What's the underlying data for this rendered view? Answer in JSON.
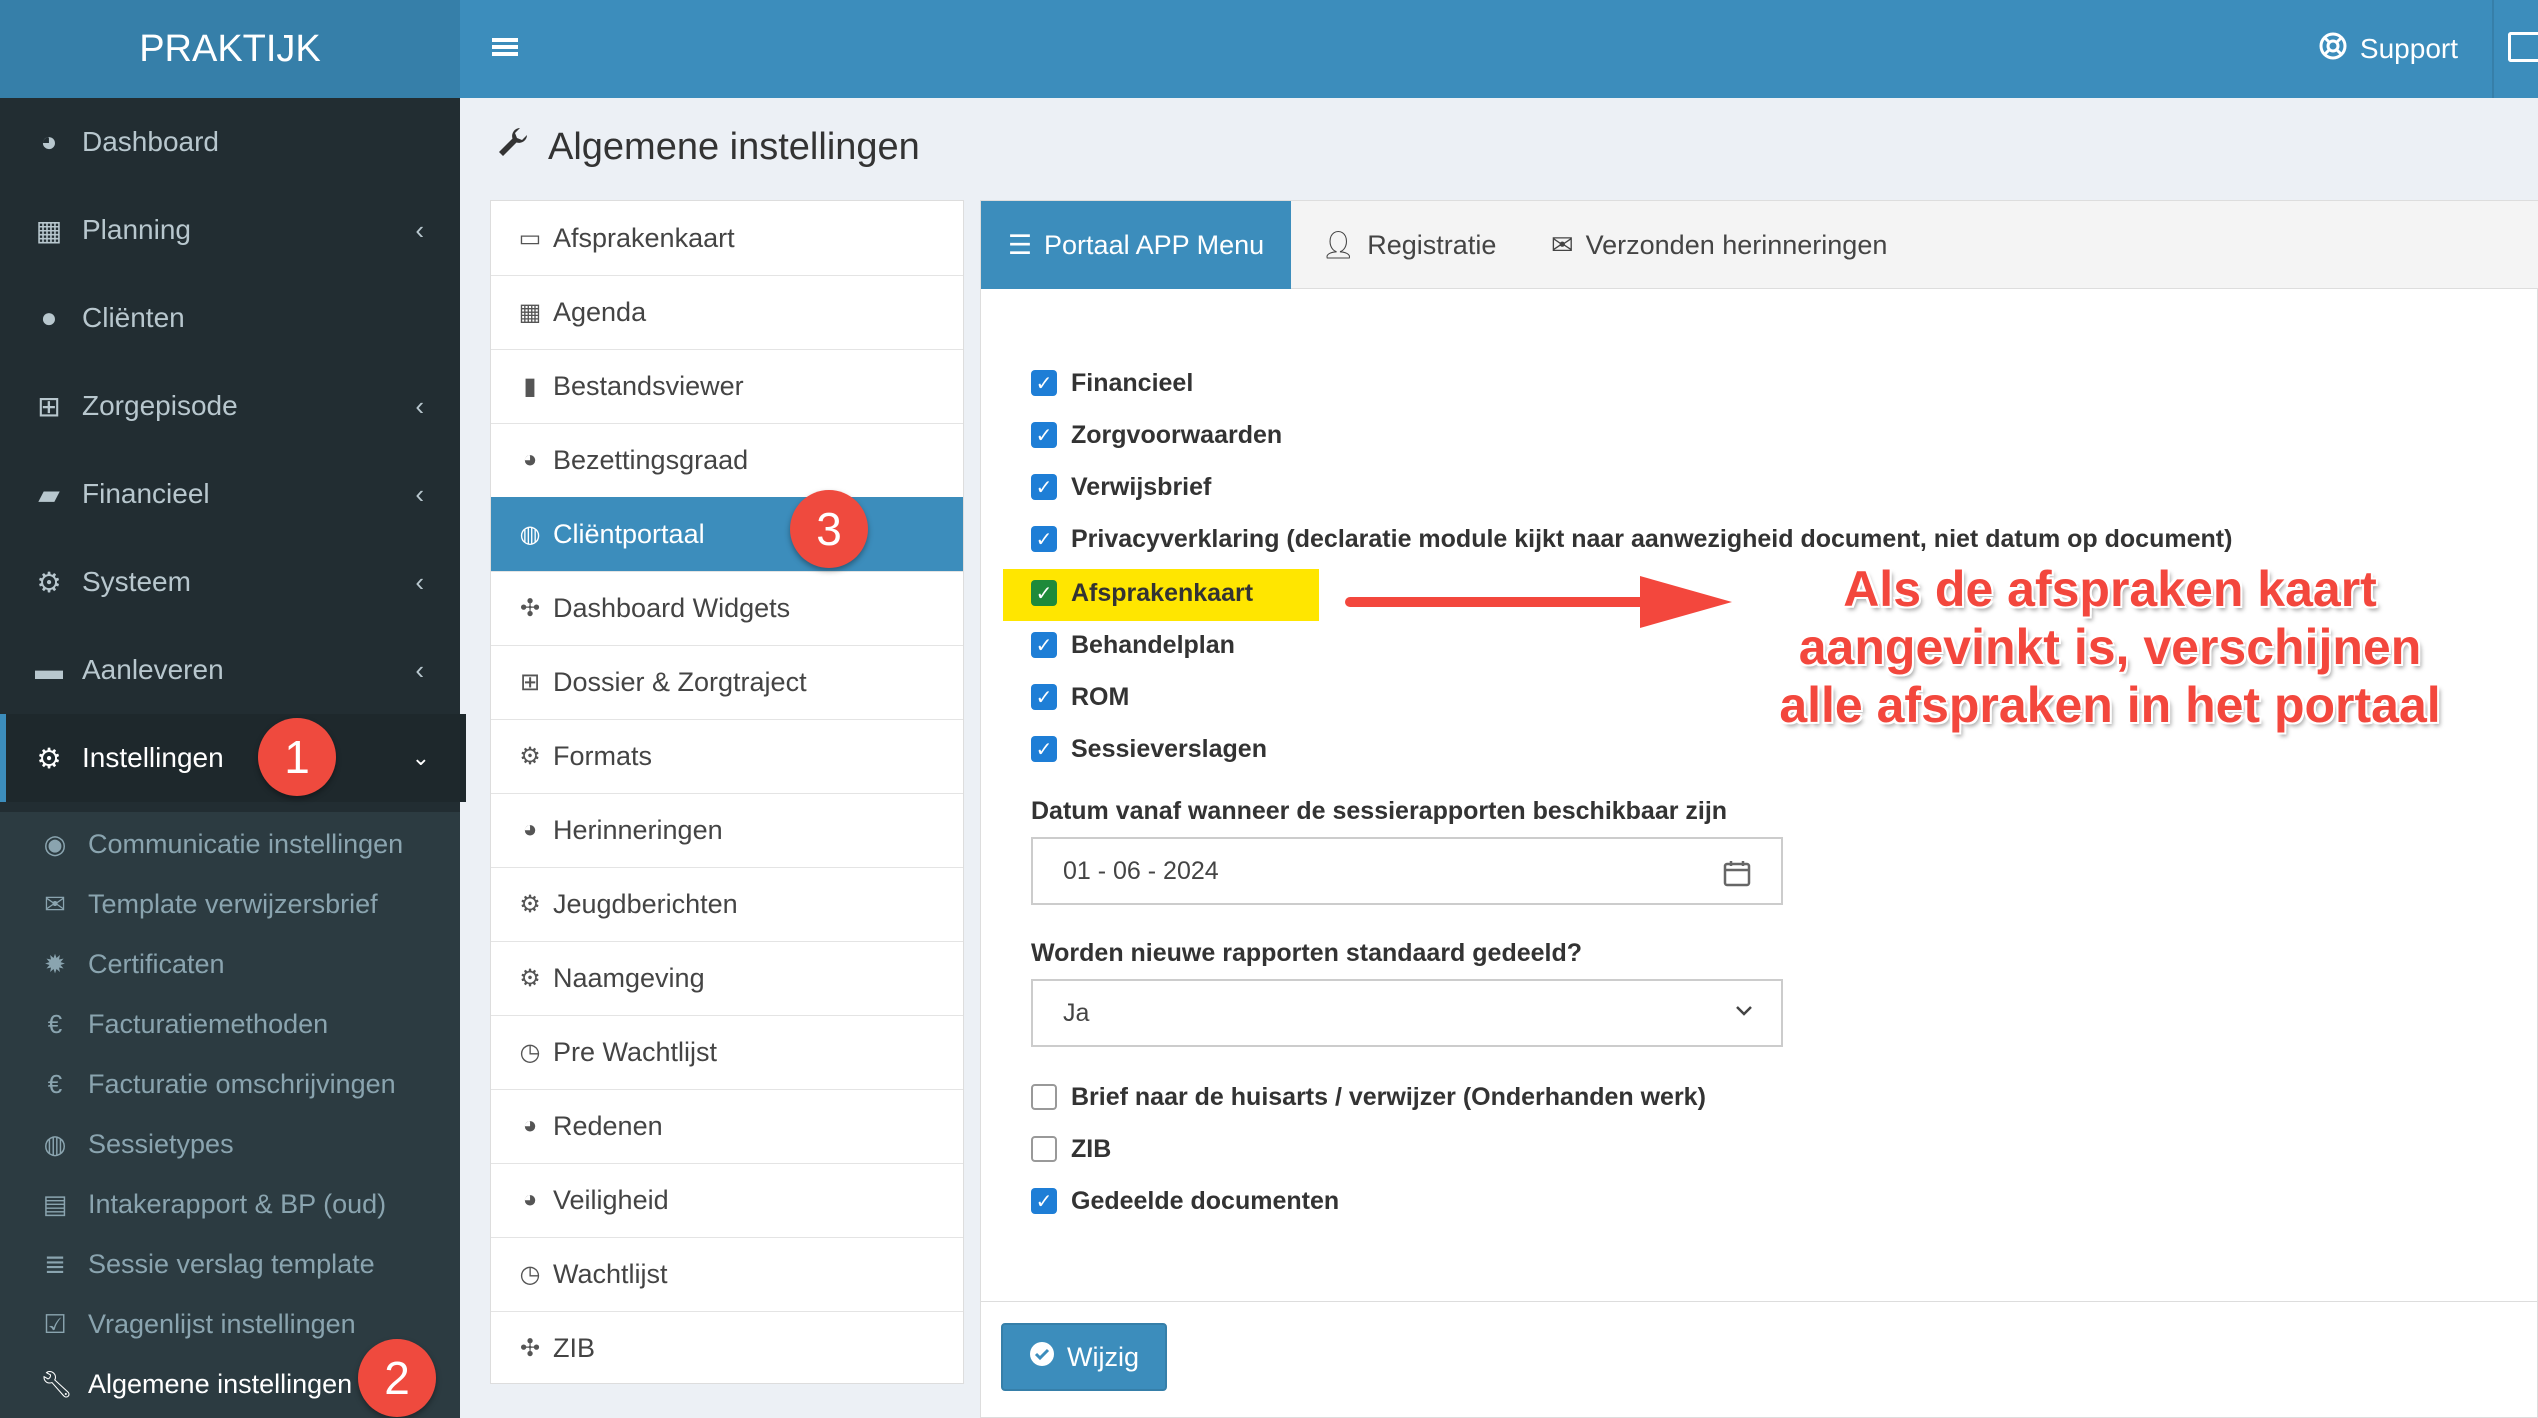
{
  "brand": "PRAKTIJK",
  "topbar": {
    "support_label": "Support"
  },
  "sidebar": {
    "items": [
      {
        "label": "Dashboard"
      },
      {
        "label": "Planning"
      },
      {
        "label": "Cliënten"
      },
      {
        "label": "Zorgepisode"
      },
      {
        "label": "Financieel"
      },
      {
        "label": "Systeem"
      },
      {
        "label": "Aanleveren"
      },
      {
        "label": "Instellingen"
      }
    ],
    "submenu": [
      {
        "label": "Communicatie instellingen"
      },
      {
        "label": "Template verwijzersbrief"
      },
      {
        "label": "Certificaten"
      },
      {
        "label": "Facturatiemethoden"
      },
      {
        "label": "Facturatie omschrijvingen"
      },
      {
        "label": "Sessietypes"
      },
      {
        "label": "Intakerapport & BP (oud)"
      },
      {
        "label": "Sessie verslag template"
      },
      {
        "label": "Vragenlijst instellingen"
      },
      {
        "label": "Algemene instellingen"
      }
    ]
  },
  "page_title": "Algemene instellingen",
  "settings_list": [
    {
      "label": "Afsprakenkaart"
    },
    {
      "label": "Agenda"
    },
    {
      "label": "Bestandsviewer"
    },
    {
      "label": "Bezettingsgraad"
    },
    {
      "label": "Cliëntportaal"
    },
    {
      "label": "Dashboard Widgets"
    },
    {
      "label": "Dossier & Zorgtraject"
    },
    {
      "label": "Formats"
    },
    {
      "label": "Herinneringen"
    },
    {
      "label": "Jeugdberichten"
    },
    {
      "label": "Naamgeving"
    },
    {
      "label": "Pre Wachtlijst"
    },
    {
      "label": "Redenen"
    },
    {
      "label": "Veiligheid"
    },
    {
      "label": "Wachtlijst"
    },
    {
      "label": "ZIB"
    }
  ],
  "tabs": [
    {
      "label": "Portaal APP Menu"
    },
    {
      "label": "Registratie"
    },
    {
      "label": "Verzonden herinneringen"
    }
  ],
  "checkboxes": [
    {
      "label": "Financieel",
      "checked": true
    },
    {
      "label": "Zorgvoorwaarden",
      "checked": true
    },
    {
      "label": "Verwijsbrief",
      "checked": true
    },
    {
      "label": "Privacyverklaring (declaratie module kijkt naar aanwezigheid document, niet datum op document)",
      "checked": true
    },
    {
      "label": "Afsprakenkaart",
      "checked": true
    },
    {
      "label": "Behandelplan",
      "checked": true
    },
    {
      "label": "ROM",
      "checked": true
    },
    {
      "label": "Sessieverslagen",
      "checked": true
    }
  ],
  "date_field": {
    "label": "Datum vanaf wanneer de sessierapporten beschikbaar zijn",
    "value": "01 - 06 - 2024"
  },
  "share_field": {
    "label": "Worden nieuwe rapporten standaard gedeeld?",
    "value": "Ja"
  },
  "checkboxes2": [
    {
      "label": "Brief naar de huisarts / verwijzer (Onderhanden werk)",
      "checked": false
    },
    {
      "label": "ZIB",
      "checked": false
    },
    {
      "label": "Gedeelde documenten",
      "checked": true
    }
  ],
  "submit_label": "Wijzig",
  "badges": [
    "1",
    "2",
    "3"
  ],
  "annotation": [
    "Als de afspraken kaart",
    "aangevinkt is, verschijnen",
    "alle afspraken in het portaal"
  ],
  "colors": {
    "primary": "#3c8dbc",
    "sidebar": "#222d32",
    "badge": "#ef4a3e",
    "highlight": "#ffe600",
    "annotation": "#f3473d"
  }
}
